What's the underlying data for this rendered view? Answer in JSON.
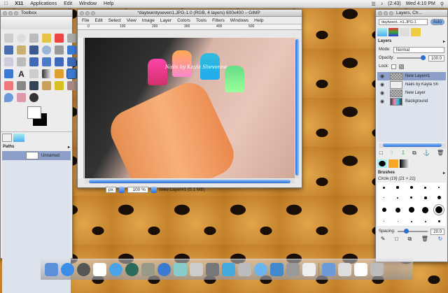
{
  "menubar": {
    "apple": "",
    "app": "X11",
    "items": [
      "Applications",
      "Edit",
      "Window",
      "Help"
    ],
    "battery": "(2:43)",
    "clock": "Wed 4:10 PM"
  },
  "toolbox": {
    "title": "Toolbox",
    "paths_header": "Paths",
    "path_item": "Unnamed"
  },
  "image_window": {
    "title": "*daytwentyseven1.JPG-1.0 (RGB, 4 layers) 600x400 – GIMP",
    "menu": [
      "File",
      "Edit",
      "Select",
      "View",
      "Image",
      "Layer",
      "Colors",
      "Tools",
      "Filters",
      "Windows",
      "Help"
    ],
    "ruler_ticks": [
      "0",
      "100",
      "200",
      "300",
      "400",
      "500"
    ],
    "watermark": "Nails by Kayla Shevonne",
    "unit": "px",
    "zoom": "100 %",
    "status": "New Layer#1 (5.1 MB)"
  },
  "layers_window": {
    "title": "Layers, Ch...",
    "image_select": "daytwent...n1.JPG-1",
    "auto_label": "Auto",
    "layers_header": "Layers",
    "mode_label": "Mode:",
    "mode_value": "Normal",
    "opacity_label": "Opacity:",
    "opacity_value": "100.0",
    "opacity_fraction": 1.0,
    "lock_label": "Lock:",
    "layers": [
      {
        "name": "New Layer#1",
        "selected": true
      },
      {
        "name": "Nails by Kayla Sh",
        "selected": false
      },
      {
        "name": "New Layer",
        "selected": false
      },
      {
        "name": "Background",
        "selected": false
      }
    ],
    "brushes_header": "Brushes",
    "brush_selected": "Circle (19) (21 × 21)",
    "spacing_label": "Spacing:",
    "spacing_value": "20.0"
  },
  "colors": {
    "accent": "#2a6fd6",
    "selection": "#8b9fc9"
  }
}
